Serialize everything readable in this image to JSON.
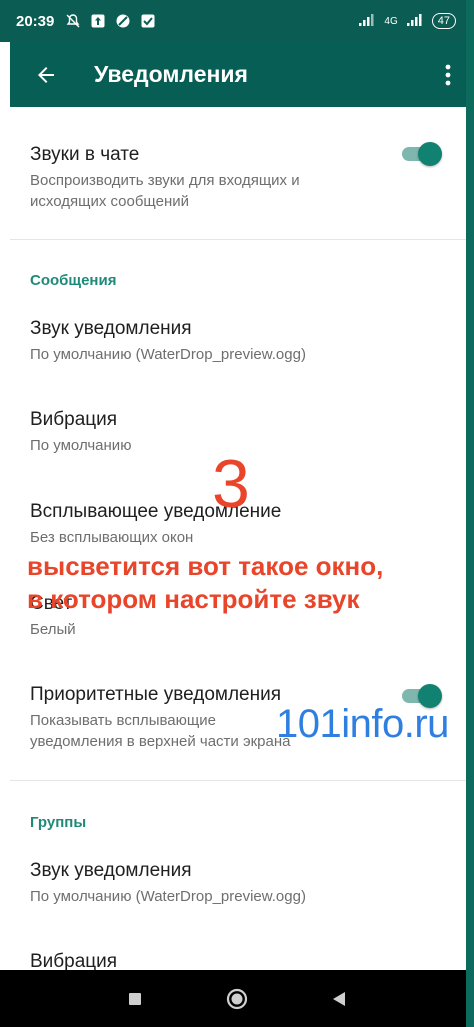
{
  "status_bar": {
    "time": "20:39",
    "network": "4G",
    "battery": "47"
  },
  "app_bar": {
    "title": "Уведомления"
  },
  "settings": {
    "chat_sounds": {
      "title": "Звуки в чате",
      "summary_line1": "Воспроизводить звуки для входящих и",
      "summary_line2": "исходящих сообщений",
      "enabled": true
    },
    "messages_section": {
      "header": "Сообщения",
      "notification_sound": {
        "title": "Звук уведомления",
        "summary": "По умолчанию (WaterDrop_preview.ogg)"
      },
      "vibration": {
        "title": "Вибрация",
        "summary": "По умолчанию"
      },
      "popup": {
        "title": "Всплывающее уведомление",
        "summary": "Без всплывающих окон"
      },
      "light": {
        "title": "Свет",
        "summary": "Белый"
      },
      "priority": {
        "title": "Приоритетные уведомления",
        "summary_line1": "Показывать всплывающие",
        "summary_line2": "уведомления в верхней части экрана",
        "enabled": true
      }
    },
    "groups_section": {
      "header": "Группы",
      "notification_sound": {
        "title": "Звук уведомления",
        "summary": "По умолчанию (WaterDrop_preview.ogg)"
      },
      "vibration": {
        "title": "Вибрация"
      }
    }
  },
  "overlay": {
    "step_number": "3",
    "note_line1": "высветится вот такое окно,",
    "note_line2": "в котором настройте звук",
    "watermark": "101info.ru"
  },
  "colors": {
    "status_bar": "#0b5c52",
    "app_bar": "#075e54",
    "accent": "#118171",
    "section_header": "#1f8a79",
    "annotation": "#e8452a",
    "watermark": "#2f7fe0"
  }
}
